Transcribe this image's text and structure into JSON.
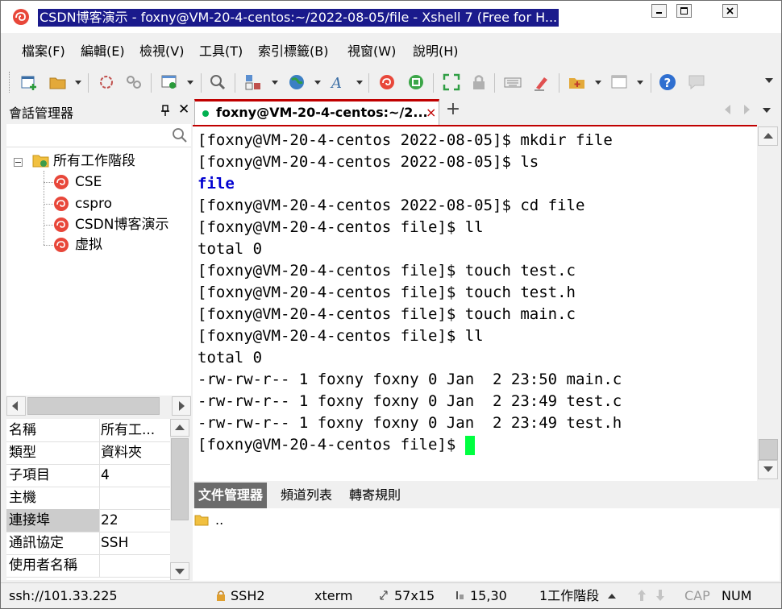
{
  "window": {
    "title": "CSDN博客演示 - foxny@VM-20-4-centos:~/2022-08-05/file - Xshell 7 (Free for H..."
  },
  "menu": [
    "檔案(F)",
    "編輯(E)",
    "檢視(V)",
    "工具(T)",
    "索引標籤(B)",
    "視窗(W)",
    "說明(H)"
  ],
  "session_pane": {
    "title": "會話管理器",
    "close": "✕",
    "tree": {
      "root": "所有工作階段",
      "children": [
        "CSE",
        "cspro",
        "CSDN博客演示",
        "虚拟"
      ]
    }
  },
  "properties": [
    {
      "key": "名稱",
      "value": "所有工..."
    },
    {
      "key": "類型",
      "value": "資料夾"
    },
    {
      "key": "子項目",
      "value": "4"
    },
    {
      "key": "主機",
      "value": ""
    },
    {
      "key": "連接埠",
      "value": "22"
    },
    {
      "key": "通訊協定",
      "value": "SSH"
    },
    {
      "key": "使用者名稱",
      "value": ""
    }
  ],
  "tab": {
    "label": "foxny@VM-20-4-centos:~/2...",
    "close": "×",
    "add": "+"
  },
  "terminal": {
    "lines": [
      {
        "text": "[foxny@VM-20-4-centos 2022-08-05]$ mkdir file",
        "kind": "normal"
      },
      {
        "text": "[foxny@VM-20-4-centos 2022-08-05]$ ls",
        "kind": "normal"
      },
      {
        "text": "file",
        "kind": "dir"
      },
      {
        "text": "[foxny@VM-20-4-centos 2022-08-05]$ cd file",
        "kind": "normal"
      },
      {
        "text": "[foxny@VM-20-4-centos file]$ ll",
        "kind": "normal"
      },
      {
        "text": "total 0",
        "kind": "normal"
      },
      {
        "text": "[foxny@VM-20-4-centos file]$ touch test.c",
        "kind": "normal"
      },
      {
        "text": "[foxny@VM-20-4-centos file]$ touch test.h",
        "kind": "normal"
      },
      {
        "text": "[foxny@VM-20-4-centos file]$ touch main.c",
        "kind": "normal"
      },
      {
        "text": "[foxny@VM-20-4-centos file]$ ll",
        "kind": "normal"
      },
      {
        "text": "total 0",
        "kind": "normal"
      },
      {
        "text": "-rw-rw-r-- 1 foxny foxny 0 Jan  2 23:50 main.c",
        "kind": "normal"
      },
      {
        "text": "-rw-rw-r-- 1 foxny foxny 0 Jan  2 23:49 test.c",
        "kind": "normal"
      },
      {
        "text": "-rw-rw-r-- 1 foxny foxny 0 Jan  2 23:49 test.h",
        "kind": "normal"
      },
      {
        "text": "[foxny@VM-20-4-centos file]$ ",
        "kind": "prompt"
      }
    ],
    "text_color": "#000000",
    "dir_color": "#0000d0",
    "cursor_color": "#00ff40"
  },
  "bottom_tabs": [
    "文件管理器",
    "頻道列表",
    "轉寄規則"
  ],
  "file_list": [
    ".."
  ],
  "status": {
    "address": "ssh://101.33.225",
    "protocol": "SSH2",
    "term": "xterm",
    "size": "57x15",
    "position": "15,30",
    "sessions": "1工作階段",
    "cap": "CAP",
    "num": "NUM"
  },
  "colors": {
    "title_highlight": "#1a1a8c",
    "tab_accent": "#c00000",
    "session_dot": "#00b050"
  }
}
